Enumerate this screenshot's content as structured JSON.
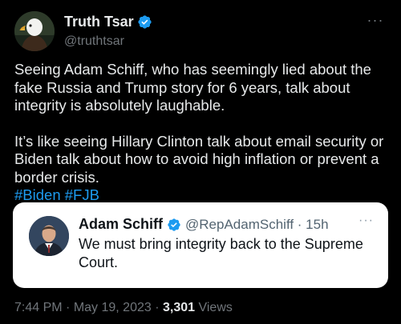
{
  "author": {
    "display_name": "Truth Tsar",
    "handle": "@truthtsar",
    "verified": true,
    "avatar_icon": "bald-eagle-avatar"
  },
  "more_icon": "···",
  "tweet": {
    "paragraph1": "Seeing Adam Schiff, who has seemingly lied about the fake Russia and Trump story for 6 years, talk about integrity is absolutely laughable.",
    "paragraph2": "It’s like seeing Hillary Clinton talk about email security or Biden talk about how to avoid high inflation or prevent a border crisis.",
    "hashtags": [
      "#Biden",
      "#FJB"
    ]
  },
  "quoted": {
    "display_name": "Adam Schiff",
    "handle_time": "@RepAdamSchiff · 15h",
    "verified": true,
    "text": "We must bring integrity back to the Supreme Court.",
    "more_icon": "···"
  },
  "meta": {
    "time": "7:44 PM",
    "separator": " · ",
    "date": "May 19, 2023",
    "views_count": "3,301",
    "views_label": " Views"
  },
  "colors": {
    "background": "#000000",
    "text": "#e7e9ea",
    "secondary": "#71767b",
    "link": "#1d9bf0",
    "verified": "#1d9bf0",
    "quote_bg": "#ffffff"
  }
}
